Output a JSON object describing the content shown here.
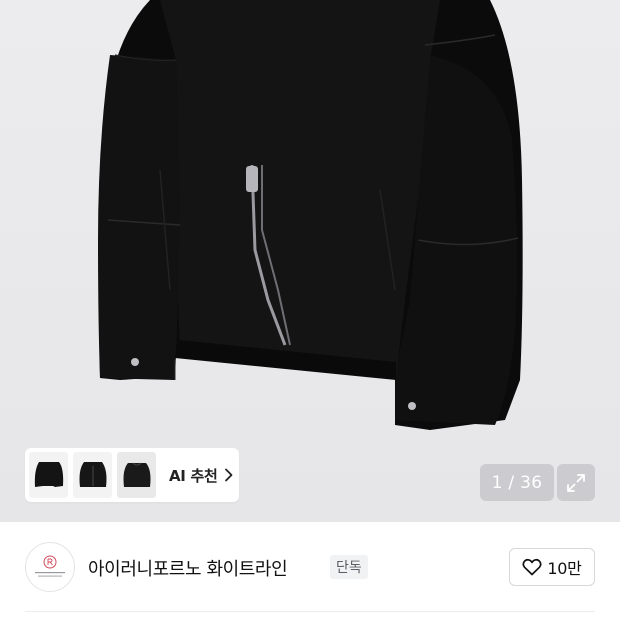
{
  "gallery": {
    "counter": "1 / 36",
    "image_description": "black jacket",
    "thumbnails": [
      {
        "name": "jacket-front"
      },
      {
        "name": "jacket-side"
      },
      {
        "name": "jacket-back"
      }
    ],
    "ai_recommend_label": "AI 추천"
  },
  "brand": {
    "name": "아이러니포르노 화이트라인",
    "badge": "단독"
  },
  "like": {
    "count": "10만"
  },
  "icons": {
    "chevron": "chevron-right-icon",
    "expand": "expand-icon",
    "heart": "heart-icon"
  }
}
